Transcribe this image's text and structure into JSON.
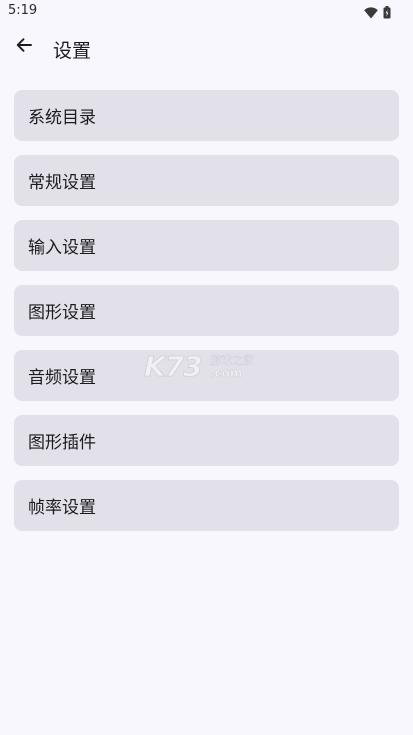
{
  "status_bar": {
    "time": "5:19",
    "icons": [
      "wifi-icon",
      "battery-icon"
    ]
  },
  "header": {
    "back_icon": "arrow-left-icon",
    "title": "设置"
  },
  "menu": {
    "items": [
      {
        "label": "系统目录"
      },
      {
        "label": "常规设置"
      },
      {
        "label": "输入设置"
      },
      {
        "label": "图形设置"
      },
      {
        "label": "音频设置"
      },
      {
        "label": "图形插件"
      },
      {
        "label": "帧率设置"
      }
    ]
  },
  "watermark": {
    "logo": "K73",
    "site_text": "游戏之家",
    "domain": ".com"
  },
  "colors": {
    "background": "#f8f7fe",
    "item_background": "#e2e1ea",
    "text": "#1c1b1f"
  }
}
